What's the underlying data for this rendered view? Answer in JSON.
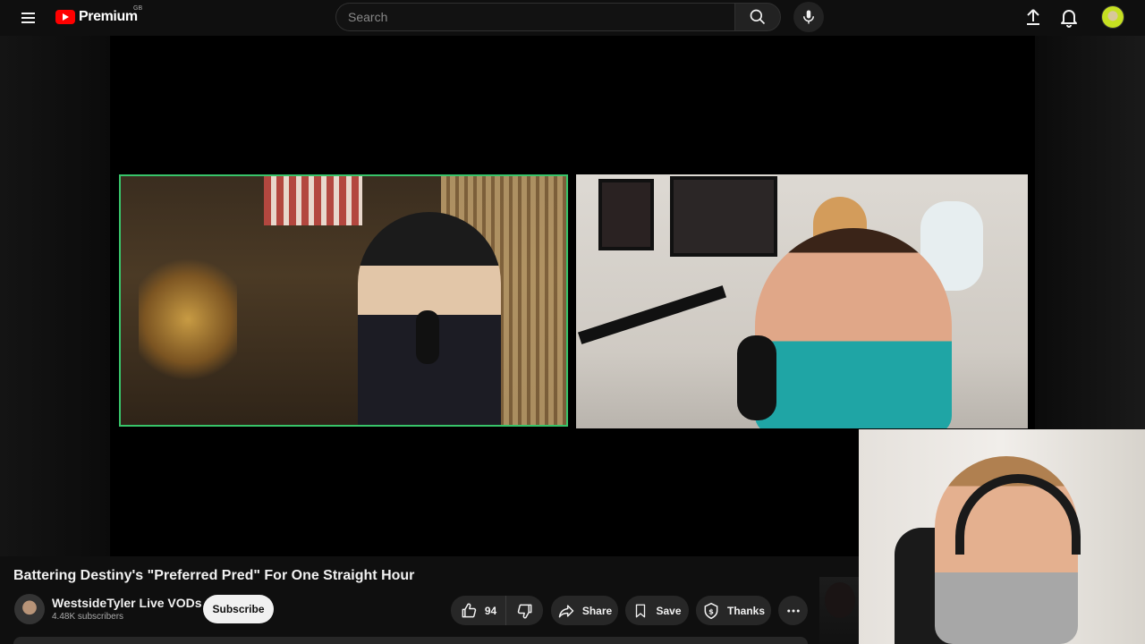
{
  "header": {
    "logo_text": "Premium",
    "logo_region": "GB",
    "search_placeholder": "Search"
  },
  "icons": {
    "menu": "hamburger-icon",
    "search": "search-icon",
    "mic": "microphone-icon",
    "upload": "upload-icon",
    "notifications": "bell-icon",
    "like": "thumbs-up-icon",
    "dislike": "thumbs-down-icon",
    "share": "share-arrow-icon",
    "save": "bookmark-icon",
    "thanks": "super-thanks-icon",
    "more": "more-horizontal-icon"
  },
  "video": {
    "title": "Battering Destiny's \"Preferred Pred\" For One Straight Hour"
  },
  "channel": {
    "name": "WestsideTyler Live VODs",
    "subscribers": "4.48K subscribers",
    "subscribe_label": "Subscribe"
  },
  "actions": {
    "like_count": "94",
    "share_label": "Share",
    "save_label": "Save",
    "thanks_label": "Thanks"
  },
  "colors": {
    "brand_red": "#ff0000",
    "background": "#0f0f0f",
    "pill_bg": "#272727",
    "active_speaker_border": "#38c46a"
  }
}
